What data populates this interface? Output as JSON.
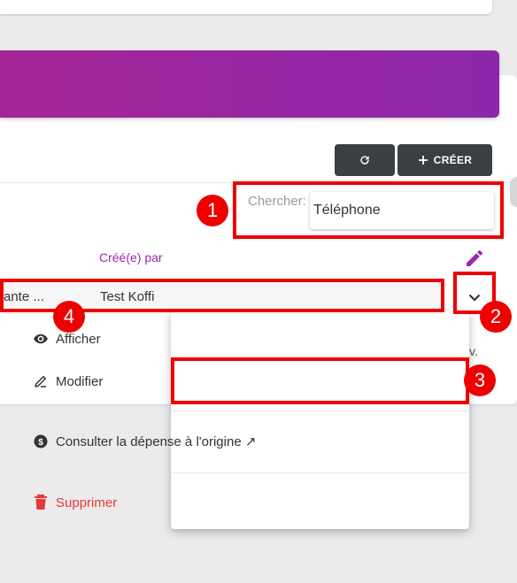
{
  "toolbar": {
    "refresh_icon": "refresh-icon",
    "create_label": "CRÉER"
  },
  "search": {
    "label": "Chercher:",
    "value": "Téléphone"
  },
  "table": {
    "columns": [
      {
        "label": "Créé(e) par"
      }
    ],
    "rows": [
      {
        "description": "ante ...",
        "created_by": "Test Koffi"
      }
    ],
    "side_text": "v."
  },
  "row_menu": {
    "items": [
      {
        "label": "Afficher",
        "icon": "eye-icon"
      },
      {
        "label": "Modifier",
        "icon": "pen-icon"
      },
      {
        "label": "Consulter la dépense à l'origine ↗",
        "icon": "dollar-circle-icon"
      },
      {
        "label": "Supprimer",
        "icon": "trash-icon"
      }
    ]
  },
  "annotations": {
    "badges": [
      "1",
      "2",
      "3",
      "4"
    ]
  },
  "colors": {
    "accent": "#9c27b0",
    "header_start": "#a52597",
    "header_end": "#8c27ab",
    "dark_button": "#3a3f44",
    "danger": "#e53935",
    "highlight": "#ee0000"
  }
}
